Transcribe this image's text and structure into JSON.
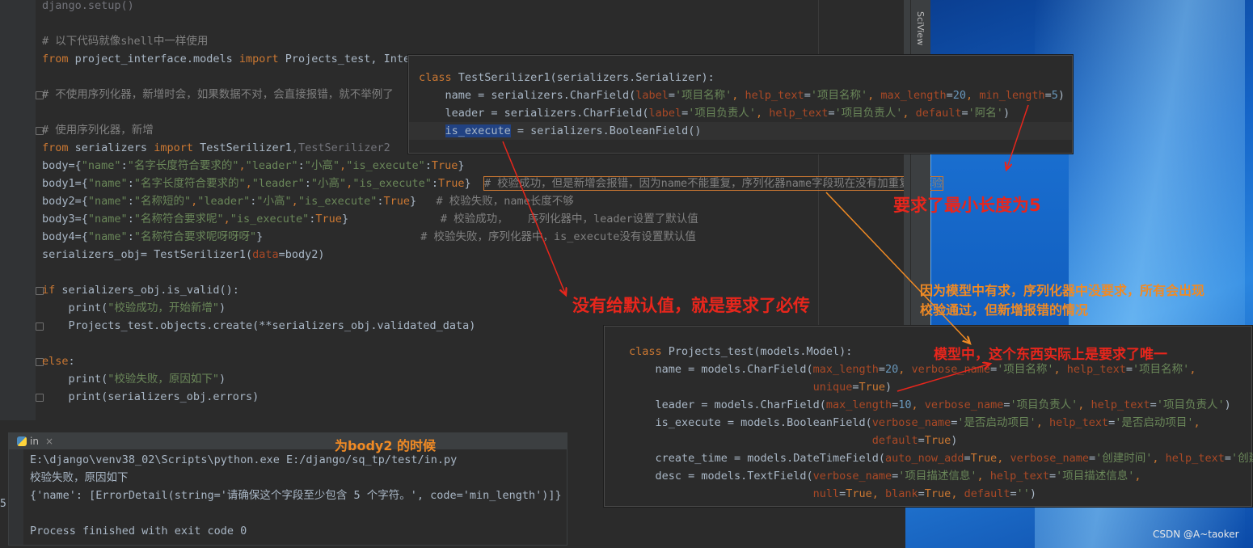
{
  "colors": {
    "keyword": "#cc7832",
    "string": "#6a8759",
    "comment": "#808080",
    "number": "#6897bb",
    "param": "#aa4926",
    "text": "#a9b7c6",
    "annotation_red": "#e8261c",
    "annotation_orange": "#f08a24"
  },
  "sidebar": {
    "sciview_label": "SciView"
  },
  "editor": {
    "l0": "django.setup()",
    "l1": "# 以下代码就像shell中一样使用",
    "l2a": "from",
    "l2b": " project_interface.models ",
    "l2c": "import",
    "l2d": " Projects_test, Inter",
    "l3": "# 不使用序列化器，新增时会，如果数据不对，会直接报错，就不举例了",
    "l4": "# 使用序列化器，新增",
    "l5a": "from",
    "l5b": " serializers ",
    "l5c": "import",
    "l5d": " TestSerilizer1",
    "l5e": ",TestSerilizer2",
    "l6a": "body={",
    "l6b": "\"name\"",
    "l6c": ":",
    "l6d": "\"名字长度符合要求的\"",
    "l6e": ",",
    "l6f": "\"leader\"",
    "l6g": ":",
    "l6h": "\"小高\"",
    "l6i": ",",
    "l6j": "\"is_execute\"",
    "l6k": ":",
    "l6l": "True",
    "l6m": "}",
    "l7a": "body1={",
    "l7b": "\"name\"",
    "l7c": ":",
    "l7d": "\"名字长度符合要求的\"",
    "l7e": ",",
    "l7f": "\"leader\"",
    "l7g": ":",
    "l7h": "\"小高\"",
    "l7i": ",",
    "l7j": "\"is_execute\"",
    "l7k": ":",
    "l7l": "True",
    "l7m": "}  ",
    "l7n": "# 校验成功，但是新增会报错，因为name不能重复，序列化器name字段现在没有加重复的校验",
    "l8a": "body2={",
    "l8b": "\"name\"",
    "l8c": ":",
    "l8d": "\"名称短的\"",
    "l8e": ",",
    "l8f": "\"leader\"",
    "l8g": ":",
    "l8h": "\"小高\"",
    "l8i": ",",
    "l8j": "\"is_execute\"",
    "l8k": ":",
    "l8l": "True",
    "l8m": "}   ",
    "l8n": "# 校验失败，name长度不够",
    "l9a": "body3={",
    "l9b": "\"name\"",
    "l9c": ":",
    "l9d": "\"名称符合要求呢\"",
    "l9e": ",",
    "l9f": "\"is_execute\"",
    "l9g": ":",
    "l9h": "True",
    "l9i": "}              ",
    "l9j": "# 校验成功，   序列化器中，leader设置了默认值",
    "l10a": "body4={",
    "l10b": "\"name\"",
    "l10c": ":",
    "l10d": "\"名称符合要求呢呀呀呀\"",
    "l10e": "}                        ",
    "l10f": "# 校验失败，序列化器中，is_execute没有设置默认值",
    "l11a": "serializers_obj= TestSerilizer1(",
    "l11b": "data",
    "l11c": "=body2)",
    "l12a": "if",
    "l12b": " serializers_obj.is_valid():",
    "l13a": "    print(",
    "l13b": "\"校验成功，开始新增\"",
    "l13c": ")",
    "l14": "    Projects_test.objects.create(**serializers_obj.validated_data)",
    "l15a": "else",
    "l15b": ":",
    "l16a": "    print(",
    "l16b": "\"校验失败，原因如下\"",
    "l16c": ")",
    "l17": "    print(serializers_obj.errors)"
  },
  "popup_serializer": {
    "p0a": "class",
    "p0b": " TestSerilizer1(serializers.Serializer):",
    "p1a": "    name = serializers.CharField(",
    "p1b": "label",
    "p1c": "=",
    "p1d": "'项目名称'",
    "p1e": ", ",
    "p1f": "help_text",
    "p1g": "=",
    "p1h": "'项目名称'",
    "p1i": ", ",
    "p1j": "max_length",
    "p1k": "=",
    "p1l": "20",
    "p1m": ", ",
    "p1n": "min_length",
    "p1o": "=",
    "p1p": "5",
    "p1q": ")",
    "p2a": "    leader = serializers.CharField(",
    "p2b": "label",
    "p2c": "=",
    "p2d": "'项目负责人'",
    "p2e": ", ",
    "p2f": "help_text",
    "p2g": "=",
    "p2h": "'项目负责人'",
    "p2i": ", ",
    "p2j": "default",
    "p2k": "=",
    "p2l": "'阿名'",
    "p2m": ")",
    "p3a": "    ",
    "p3b": "is_execute",
    "p3c": " = serializers.BooleanField()"
  },
  "popup_model": {
    "m0a": "class",
    "m0b": " Projects_test(models.Model):",
    "m1a": "    name = models.CharField(",
    "m1b": "max_length",
    "m1c": "=",
    "m1d": "20",
    "m1e": ", ",
    "m1f": "verbose_name",
    "m1g": "=",
    "m1h": "'项目名称'",
    "m1i": ", ",
    "m1j": "help_text",
    "m1k": "=",
    "m1l": "'项目名称'",
    "m1m": ",",
    "m2a": "                            ",
    "m2b": "unique",
    "m2c": "=",
    "m2d": "True",
    "m2e": ")",
    "m3a": "    leader = models.CharField(",
    "m3b": "max_length",
    "m3c": "=",
    "m3d": "10",
    "m3e": ", ",
    "m3f": "verbose_name",
    "m3g": "=",
    "m3h": "'项目负责人'",
    "m3i": ", ",
    "m3j": "help_text",
    "m3k": "=",
    "m3l": "'项目负责人'",
    "m3m": ")",
    "m4a": "    is_execute = models.BooleanField(",
    "m4b": "verbose_name",
    "m4c": "=",
    "m4d": "'是否启动项目'",
    "m4e": ", ",
    "m4f": "help_text",
    "m4g": "=",
    "m4h": "'是否启动项目'",
    "m4i": ",",
    "m5a": "                                     ",
    "m5b": "default",
    "m5c": "=",
    "m5d": "True",
    "m5e": ")",
    "m6a": "    create_time = models.DateTimeField(",
    "m6b": "auto_now_add",
    "m6c": "=",
    "m6d": "True",
    "m6e": ", ",
    "m6f": "verbose_name",
    "m6g": "=",
    "m6h": "'创建时间'",
    "m6i": ", ",
    "m6j": "help_text",
    "m6k": "=",
    "m6l": "'创建时",
    "m7a": "    desc = models.TextField(",
    "m7b": "verbose_name",
    "m7c": "=",
    "m7d": "'项目描述信息'",
    "m7e": ", ",
    "m7f": "help_text",
    "m7g": "=",
    "m7h": "'项目描述信息'",
    "m7i": ",",
    "m8a": "                            ",
    "m8b": "null",
    "m8c": "=",
    "m8d": "True",
    "m8e": ", ",
    "m8f": "blank",
    "m8g": "=",
    "m8h": "True",
    "m8i": ", ",
    "m8j": "default",
    "m8k": "=",
    "m8l": "''",
    "m8m": ")"
  },
  "run_panel": {
    "tab_label": "in",
    "close_glyph": "×",
    "out0": "E:\\django\\venv38_02\\Scripts\\python.exe E:/django/sq_tp/test/in.py",
    "out1": "校验失败，原因如下",
    "out2": "{'name': [ErrorDetail(string='请确保这个字段至少包含 5 个字符。', code='min_length')]}",
    "out3": "",
    "out4": "Process finished with exit code 0",
    "left_marker": "5"
  },
  "annotations": {
    "min_length": "要求了最小长度为5",
    "no_default": "没有给默认值，就是要求了必传",
    "model_vs_serializer_1": "因为模型中有求，序列化器中没要求，所有会出现",
    "model_vs_serializer_2": "校验通过，但新增报错的情况",
    "unique": "模型中，这个东西实际上是要求了唯一",
    "body2": "为body2 的时候"
  },
  "watermark": "CSDN @A~taoker"
}
